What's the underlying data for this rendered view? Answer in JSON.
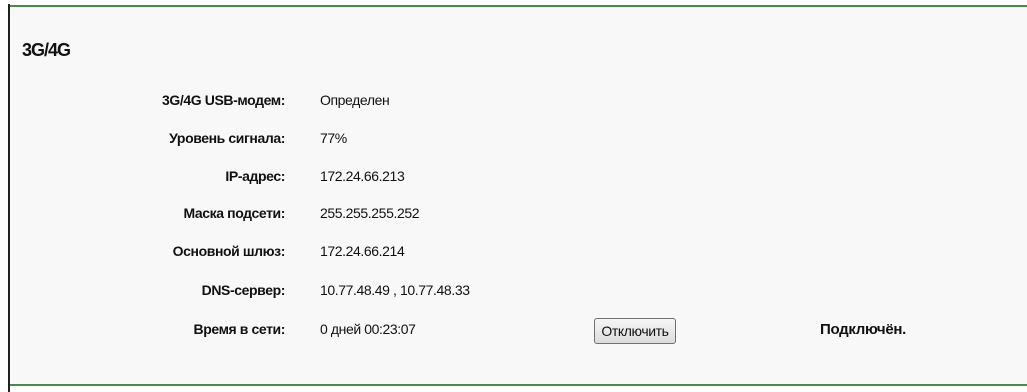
{
  "section": {
    "title": "3G/4G"
  },
  "rows": [
    {
      "label": "3G/4G USB-модем:",
      "value": "Определен"
    },
    {
      "label": "Уровень сигнала:",
      "value": "77%"
    },
    {
      "label": "IP-адрес:",
      "value": "172.24.66.213"
    },
    {
      "label": "Маска подсети:",
      "value": "255.255.255.252"
    },
    {
      "label": "Основной шлюз:",
      "value": "172.24.66.214"
    },
    {
      "label": "DNS-сервер:",
      "value": "10.77.48.49 , 10.77.48.33"
    },
    {
      "label": "Время в сети:",
      "value": "0 дней 00:23:07"
    }
  ],
  "disconnect_button": {
    "label": "Отключить"
  },
  "connection_status": "Подключён.",
  "colors": {
    "rule": "#4c8a4c",
    "panel_bg": "#f8f8f8"
  }
}
